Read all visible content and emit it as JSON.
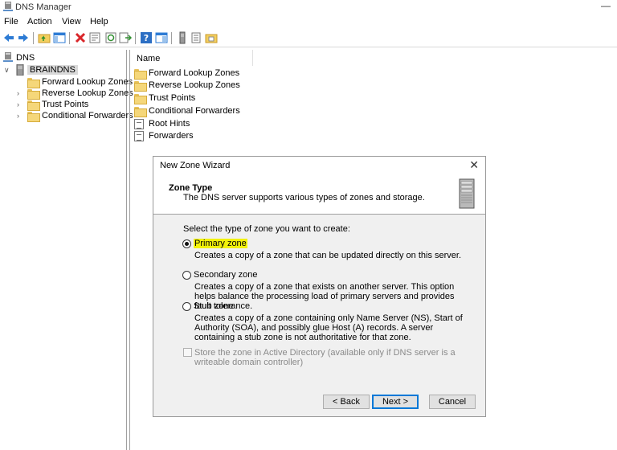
{
  "window": {
    "title": "DNS Manager",
    "minimize": "—"
  },
  "menu": [
    "File",
    "Action",
    "View",
    "Help"
  ],
  "toolbar_icons": [
    "back-icon",
    "forward-icon",
    "folder-up-icon",
    "show-hide-tree-icon",
    "delete-icon",
    "properties-icon",
    "refresh-icon",
    "export-icon",
    "help-icon",
    "view-icon",
    "server-icon",
    "list-icon",
    "folder-icon"
  ],
  "tree": {
    "root": "DNS",
    "server": "BRAINDNS",
    "items": [
      "Forward Lookup Zones",
      "Reverse Lookup Zones",
      "Trust Points",
      "Conditional Forwarders"
    ]
  },
  "list": {
    "column": "Name",
    "items": [
      {
        "name": "Forward Lookup Zones",
        "icon": "folder-icon"
      },
      {
        "name": "Reverse Lookup Zones",
        "icon": "folder-icon"
      },
      {
        "name": "Trust Points",
        "icon": "folder-icon"
      },
      {
        "name": "Conditional Forwarders",
        "icon": "folder-icon"
      },
      {
        "name": "Root Hints",
        "icon": "document-icon"
      },
      {
        "name": "Forwarders",
        "icon": "document-icon"
      }
    ]
  },
  "wizard": {
    "title": "New Zone Wizard",
    "heading": "Zone Type",
    "subheading": "The DNS server supports various types of zones and storage.",
    "prompt": "Select the type of zone you want to create:",
    "options": [
      {
        "label": "Primary zone",
        "selected": true,
        "description": "Creates a copy of a zone that can be updated directly on this server."
      },
      {
        "label": "Secondary zone",
        "selected": false,
        "description": "Creates a copy of a zone that exists on another server. This option helps balance the processing load of primary servers and provides fault tolerance."
      },
      {
        "label": "Stub zone",
        "selected": false,
        "description": "Creates a copy of a zone containing only Name Server (NS), Start of Authority (SOA), and possibly glue Host (A) records. A server containing a stub zone is not authoritative for that zone."
      }
    ],
    "ad_checkbox": {
      "label": "Store the zone in Active Directory (available only if DNS server is a writeable domain controller)",
      "checked": false,
      "enabled": false
    },
    "buttons": {
      "back": "< Back",
      "next": "Next >",
      "cancel": "Cancel"
    },
    "highlight_color": "#f2f20a"
  }
}
